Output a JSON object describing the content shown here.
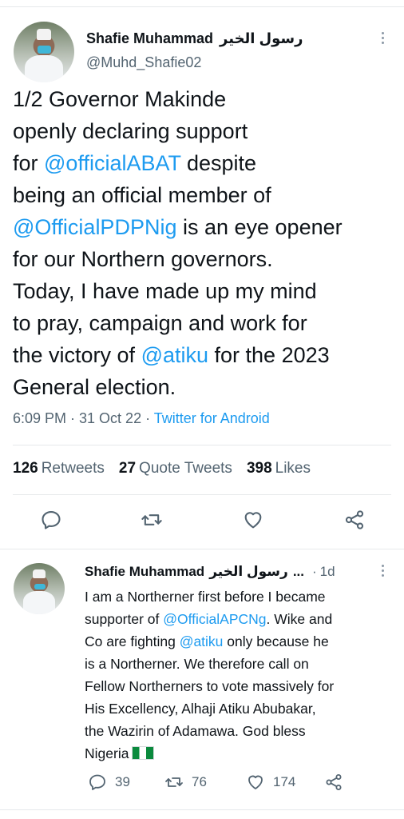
{
  "main_tweet": {
    "author_name": "Shafie Muhammad",
    "author_name_arabic": "رسول الخير",
    "handle": "@Muhd_Shafie02",
    "body_lines": [
      [
        {
          "t": "1/2 Governor Makinde"
        }
      ],
      [
        {
          "t": "openly declaring support"
        }
      ],
      [
        {
          "t": "for "
        },
        {
          "t": "@officialABAT",
          "m": true
        },
        {
          "t": " despite"
        }
      ],
      [
        {
          "t": "being an official member of"
        }
      ],
      [
        {
          "t": "@OfficialPDPNig",
          "m": true
        },
        {
          "t": " is an eye opener"
        }
      ],
      [
        {
          "t": "for our Northern governors."
        }
      ],
      [
        {
          "t": "Today, I have made up my mind"
        }
      ],
      [
        {
          "t": "to pray, campaign and work for"
        }
      ],
      [
        {
          "t": "the victory of "
        },
        {
          "t": "@atiku",
          "m": true
        },
        {
          "t": " for the 2023"
        }
      ],
      [
        {
          "t": "General election."
        }
      ]
    ],
    "time": "6:09 PM · 31 Oct 22 · ",
    "source": "Twitter for Android",
    "retweets_count": "126",
    "retweets_label": "Retweets",
    "quote_count": "27",
    "quote_label": "Quote Tweets",
    "likes_count": "398",
    "likes_label": "Likes"
  },
  "reply_tweet": {
    "author_name": "Shafie Muhammad",
    "author_name_arabic": "رسول الخير",
    "ellipsis": "...",
    "separator": "·",
    "time": "1d",
    "body_lines": [
      [
        {
          "t": "I am a Northerner first before I became"
        }
      ],
      [
        {
          "t": "supporter of "
        },
        {
          "t": "@OfficialAPCNg",
          "m": true
        },
        {
          "t": ". Wike and"
        }
      ],
      [
        {
          "t": "Co are fighting "
        },
        {
          "t": "@atiku",
          "m": true
        },
        {
          "t": " only because he"
        }
      ],
      [
        {
          "t": "is a Northerner. We therefore call on"
        }
      ],
      [
        {
          "t": "Fellow Northerners to vote massively for"
        }
      ],
      [
        {
          "t": "His Excellency, Alhaji Atiku Abubakar,"
        }
      ],
      [
        {
          "t": "the Wazirin of Adamawa. God bless"
        }
      ],
      [
        {
          "t": "Nigeria",
          "flag": true
        }
      ]
    ],
    "replies": "39",
    "retweets": "76",
    "likes": "174"
  },
  "colors": {
    "accent": "#1d9bf0",
    "secondary": "#536471",
    "text": "#0f1419"
  },
  "icons": [
    "reply-icon",
    "retweet-icon",
    "like-icon",
    "share-icon",
    "more-icon",
    "nigeria-flag-emoji"
  ]
}
